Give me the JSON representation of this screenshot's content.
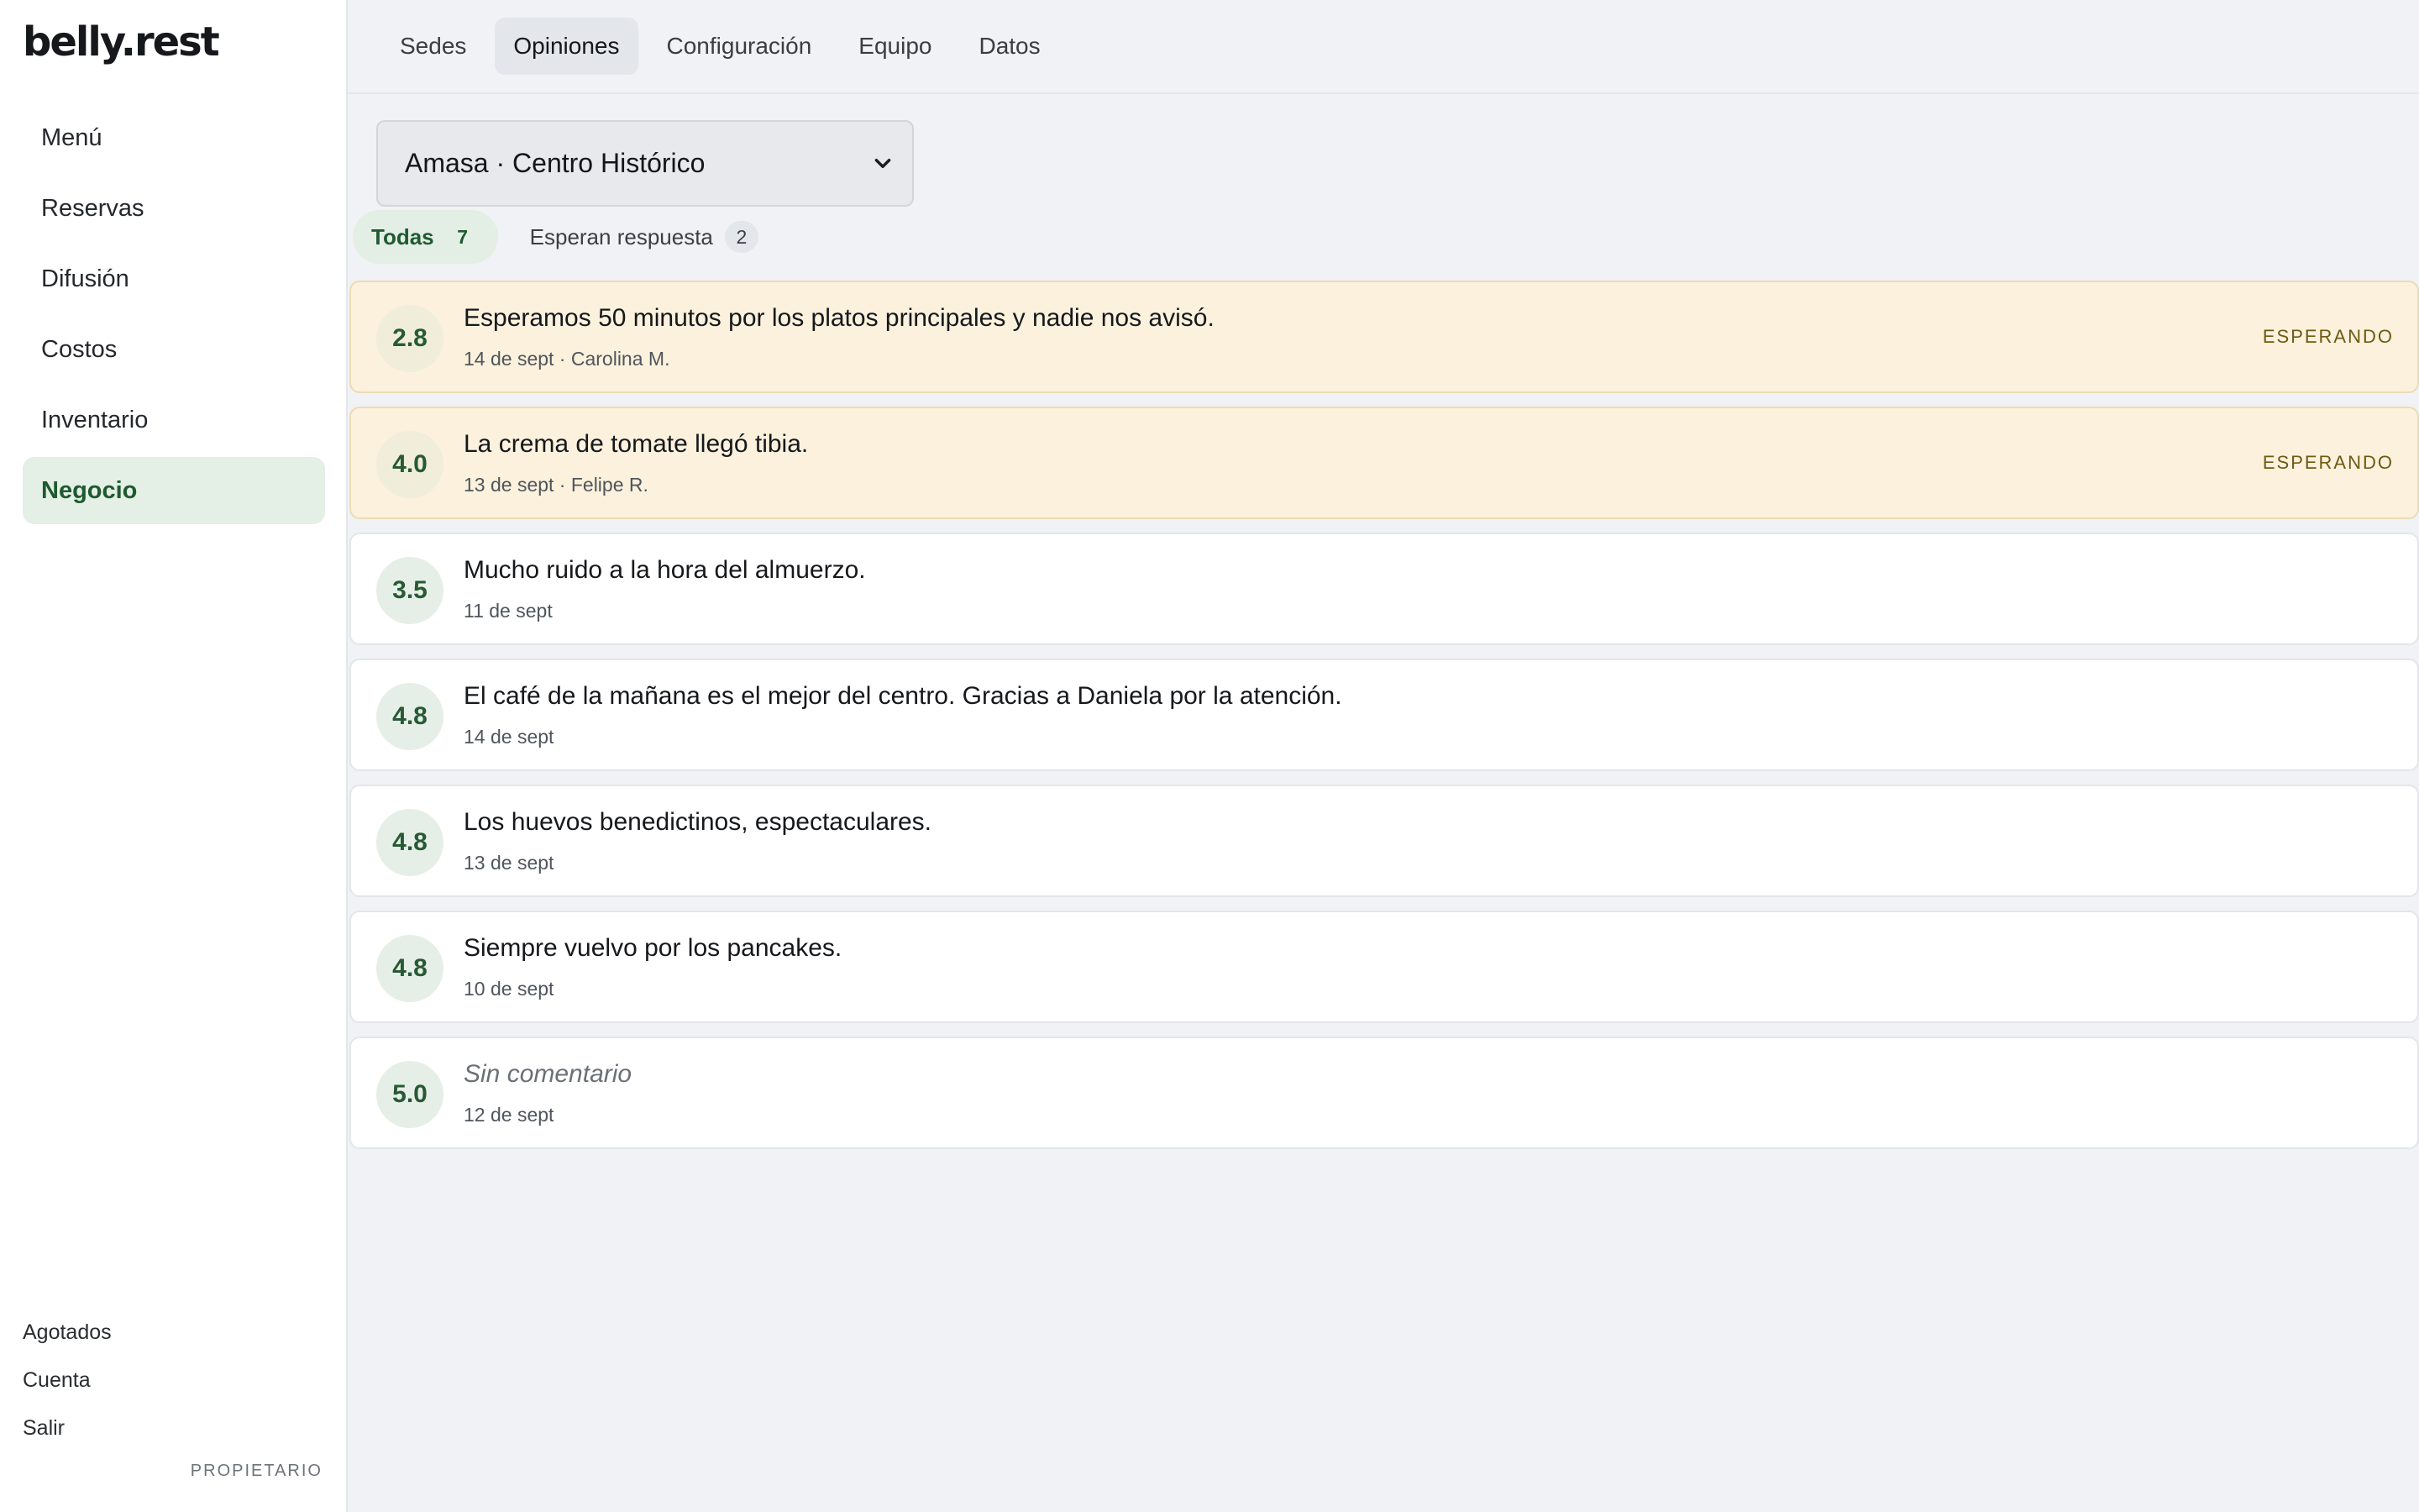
{
  "app": {
    "logo": "belly.rest"
  },
  "sidebar": {
    "items": [
      {
        "label": "Menú",
        "active": false
      },
      {
        "label": "Reservas",
        "active": false
      },
      {
        "label": "Difusión",
        "active": false
      },
      {
        "label": "Costos",
        "active": false
      },
      {
        "label": "Inventario",
        "active": false
      },
      {
        "label": "Negocio",
        "active": true
      }
    ],
    "bottom": {
      "agotados": "Agotados",
      "cuenta": "Cuenta",
      "salir": "Salir"
    },
    "role": "PROPIETARIO"
  },
  "tabs": [
    {
      "label": "Sedes",
      "active": false
    },
    {
      "label": "Opiniones",
      "active": true
    },
    {
      "label": "Configuración",
      "active": false
    },
    {
      "label": "Equipo",
      "active": false
    },
    {
      "label": "Datos",
      "active": false
    }
  ],
  "location_select": {
    "value": "Amasa · Centro Histórico"
  },
  "filters": {
    "all": {
      "label": "Todas",
      "count": "7"
    },
    "pending": {
      "label": "Esperan respuesta",
      "count": "2"
    }
  },
  "reviews": [
    {
      "score": "2.8",
      "text": "Esperamos 50 minutos por los platos principales y nadie nos avisó.",
      "meta": "14 de sept · Carolina M.",
      "status": "ESPERANDO"
    },
    {
      "score": "4.0",
      "text": "La crema de tomate llegó tibia.",
      "meta": "13 de sept · Felipe R.",
      "status": "ESPERANDO"
    },
    {
      "score": "3.5",
      "text": "Mucho ruido a la hora del almuerzo.",
      "meta": "11 de sept",
      "status": ""
    },
    {
      "score": "4.8",
      "text": "El café de la mañana es el mejor del centro. Gracias a Daniela por la atención.",
      "meta": "14 de sept",
      "status": ""
    },
    {
      "score": "4.8",
      "text": "Los huevos benedictinos, espectaculares.",
      "meta": "13 de sept",
      "status": ""
    },
    {
      "score": "4.8",
      "text": "Siempre vuelvo por los pancakes.",
      "meta": "10 de sept",
      "status": ""
    },
    {
      "score": "5.0",
      "text": "Sin comentario",
      "meta": "12 de sept",
      "status": "",
      "empty": true
    }
  ],
  "colors": {
    "accent": "#1e5a30",
    "pending_bg": "#fbf1dd",
    "pending_text": "#6d5a12"
  }
}
